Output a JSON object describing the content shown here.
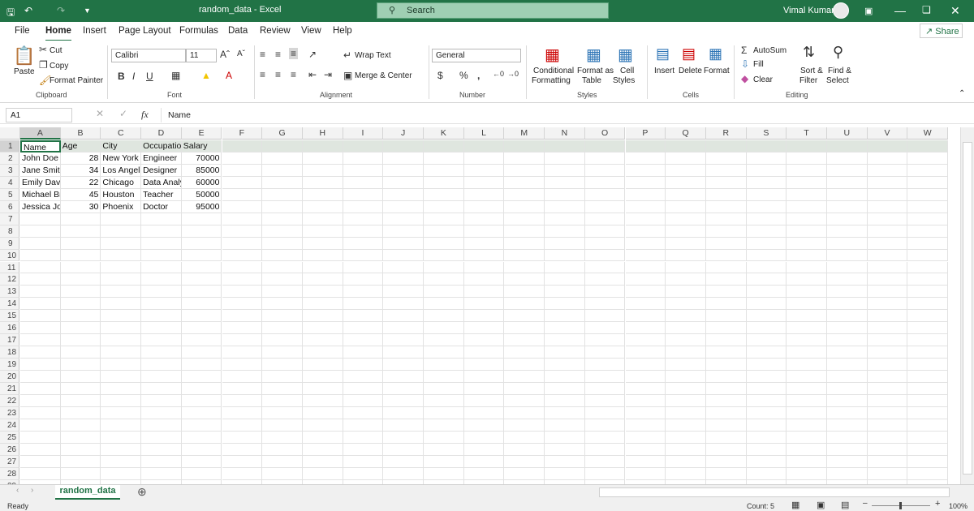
{
  "title": "random_data  -  Excel",
  "search_placeholder": "Search",
  "user": "Vimal Kumar",
  "menu_tabs": [
    "File",
    "Home",
    "Insert",
    "Page Layout",
    "Formulas",
    "Data",
    "Review",
    "View",
    "Help"
  ],
  "share": "Share",
  "ribbon": {
    "clipboard": {
      "paste": "Paste",
      "cut": "Cut",
      "copy": "Copy",
      "painter": "Format Painter",
      "label": "Clipboard"
    },
    "font": {
      "name": "Calibri",
      "size": "11",
      "label": "Font"
    },
    "alignment": {
      "wrap": "Wrap Text",
      "merge": "Merge & Center",
      "label": "Alignment"
    },
    "number": {
      "format": "General",
      "label": "Number"
    },
    "styles": {
      "conditional": "Conditional",
      "formatting": "Formatting",
      "format_as": "Format as",
      "table": "Table",
      "cell": "Cell",
      "cell_styles": "Styles",
      "label": "Styles"
    },
    "cells": {
      "insert": "Insert",
      "delete": "Delete",
      "format": "Format",
      "label": "Cells"
    },
    "editing": {
      "autosum": "AutoSum",
      "fill": "Fill",
      "clear": "Clear",
      "sort": "Sort &",
      "filter": "Filter",
      "find": "Find &",
      "select": "Select",
      "label": "Editing"
    }
  },
  "name_box": "A1",
  "formula": "Name",
  "columns": [
    "A",
    "B",
    "C",
    "D",
    "E",
    "F",
    "G",
    "H",
    "I",
    "J",
    "K",
    "L",
    "M",
    "N",
    "O",
    "P",
    "Q",
    "R",
    "S",
    "T",
    "U",
    "V",
    "W"
  ],
  "table": {
    "headers": [
      "Name",
      "Age",
      "City",
      "Occupatio",
      "Salary"
    ],
    "rows": [
      [
        "John Doe",
        "28",
        "New York",
        "Engineer",
        "70000"
      ],
      [
        "Jane Smith",
        "34",
        "Los Angele",
        "Designer",
        "85000"
      ],
      [
        "Emily Davi",
        "22",
        "Chicago",
        "Data Analy",
        "60000"
      ],
      [
        "Michael Br",
        "45",
        "Houston",
        "Teacher",
        "50000"
      ],
      [
        "Jessica Joh",
        "30",
        "Phoenix",
        "Doctor",
        "95000"
      ]
    ]
  },
  "row_numbers": [
    "1",
    "2",
    "3",
    "4",
    "5",
    "6",
    "7",
    "8",
    "9",
    "10",
    "11",
    "12",
    "13",
    "14",
    "15",
    "16",
    "17",
    "18",
    "19",
    "20",
    "21",
    "22",
    "23",
    "24",
    "25",
    "26",
    "27",
    "28",
    "29"
  ],
  "sheet_tab": "random_data",
  "status": {
    "ready": "Ready",
    "count": "Count: 5",
    "zoom": "100%"
  },
  "colors": {
    "accent": "#217346"
  }
}
